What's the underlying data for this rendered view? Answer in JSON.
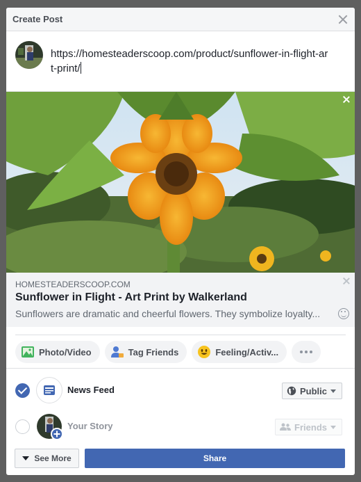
{
  "dialog": {
    "title": "Create Post",
    "close_icon": "close-icon"
  },
  "composer": {
    "text": "https://homesteaderscoop.com/product/sunflower-in-flight-art-print/"
  },
  "link_preview": {
    "domain": "HOMESTEADERSCOOP.COM",
    "title": "Sunflower in Flight - Art Print by Walkerland",
    "description": "Sunflowers are dramatic and cheerful flowers. They symbolize loyalty..."
  },
  "actions": [
    {
      "label": "Photo/Video",
      "icon": "photo-icon"
    },
    {
      "label": "Tag Friends",
      "icon": "tag-friends-icon"
    },
    {
      "label": "Feeling/Activ...",
      "icon": "feeling-icon"
    },
    {
      "label": "",
      "icon": "more-icon"
    }
  ],
  "destinations": {
    "news_feed": {
      "label": "News Feed",
      "checked": true,
      "privacy": "Public"
    },
    "your_story": {
      "label": "Your Story",
      "checked": false,
      "privacy": "Friends"
    }
  },
  "footer": {
    "see_more": "See More",
    "share": "Share"
  },
  "colors": {
    "primary": "#4267b2",
    "overlay": "#5f5f5f"
  }
}
